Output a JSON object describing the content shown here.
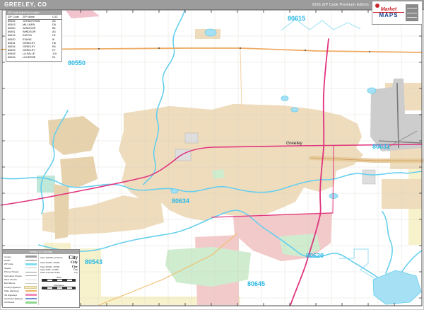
{
  "header": {
    "title": "GREELEY, CO",
    "edition": "2026 ZIP Code Premium Edition"
  },
  "logo": {
    "brand_line1": "Market",
    "brand_line2": "MAPS"
  },
  "zip_table": {
    "title": "ZIP Code Index/Grid Locator",
    "columns": [
      "ZIP Code",
      "ZIP Name",
      "LOC"
    ],
    "rows": [
      {
        "code": "80534",
        "name": "JOHNSTOWN",
        "loc": "A9"
      },
      {
        "code": "80543",
        "name": "MILLIKEN",
        "loc": "D9"
      },
      {
        "code": "80550",
        "name": "WINDSOR",
        "loc": "B4"
      },
      {
        "code": "80551",
        "name": "WINDSOR",
        "loc": "A3"
      },
      {
        "code": "80615",
        "name": "EATON",
        "loc": "H1"
      },
      {
        "code": "80620",
        "name": "EVANS",
        "loc": "I6"
      },
      {
        "code": "80631",
        "name": "GREELEY",
        "loc": "H6"
      },
      {
        "code": "80634",
        "name": "GREELEY",
        "loc": "E8"
      },
      {
        "code": "80639",
        "name": "GREELEY",
        "loc": "K7"
      },
      {
        "code": "80645",
        "name": "LA SALLE",
        "loc": "J10"
      },
      {
        "code": "80646",
        "name": "LUCERNE",
        "loc": "K1"
      }
    ]
  },
  "legend": {
    "title": "Greeley CO City Map",
    "road_items": [
      {
        "label": "County"
      },
      {
        "label": "Roads"
      },
      {
        "label": "ZIP Code"
      },
      {
        "label": "Streets"
      },
      {
        "label": "Primary Streets"
      },
      {
        "label": "Secondary Streets"
      },
      {
        "label": "Minor Streets"
      },
      {
        "label": "Exit Ramps"
      },
      {
        "label": "County Highways"
      },
      {
        "label": "State Highways"
      },
      {
        "label": "US Highways"
      },
      {
        "label": "Interstate Highways"
      },
      {
        "label": "Toll Roads"
      }
    ],
    "city_items": [
      {
        "label": "Cities 100,000 and Above",
        "example": "City"
      },
      {
        "label": "Cities 50,000 - 99,999",
        "example": "City"
      },
      {
        "label": "Cities 25,000 - 49,999",
        "example": "City"
      },
      {
        "label": "Cities 5,000 - 24,999",
        "example": "City"
      },
      {
        "label": "Cities Less than 5,000",
        "example": "City"
      }
    ],
    "scale": {
      "miles": "Miles",
      "kilometers": "Kilometers"
    }
  },
  "map": {
    "zip_labels": [
      {
        "text": "80550"
      },
      {
        "text": "80615"
      },
      {
        "text": "80631"
      },
      {
        "text": "80634"
      },
      {
        "text": "80620"
      },
      {
        "text": "80645"
      },
      {
        "text": "80543"
      }
    ],
    "city_labels": [
      {
        "text": "Greeley"
      }
    ],
    "colors": {
      "zip_label": "#29b8e5",
      "urban_tan": "#eedcbd",
      "urban_pink": "#f3caca",
      "water_fill": "#a5e0f4",
      "river": "#66cfee",
      "highway_magenta": "#e0357f",
      "road_orange": "#eeab62",
      "park_green": "#cfeccf",
      "airport_gray": "#cdcdcd",
      "header_bar": "#9c9c9c"
    }
  }
}
